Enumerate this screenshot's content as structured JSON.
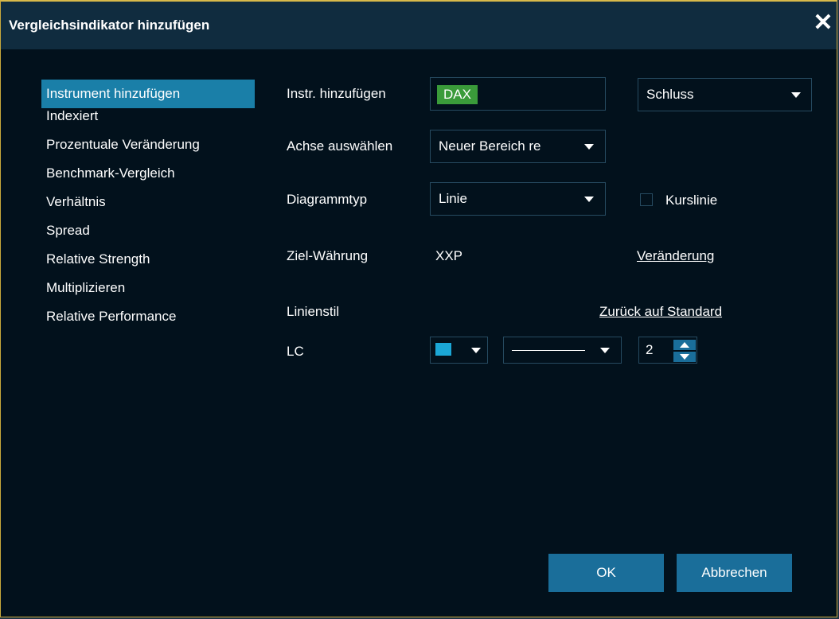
{
  "dialog": {
    "title": "Vergleichsindikator hinzufügen",
    "close_glyph": "✕"
  },
  "sidebar": {
    "items": [
      {
        "label": "Instrument hinzufügen",
        "active": true
      },
      {
        "label": "Indexiert"
      },
      {
        "label": "Prozentuale Veränderung"
      },
      {
        "label": "Benchmark-Vergleich"
      },
      {
        "label": "Verhältnis"
      },
      {
        "label": "Spread"
      },
      {
        "label": "Relative Strength"
      },
      {
        "label": "Multiplizieren"
      },
      {
        "label": "Relative Performance"
      }
    ]
  },
  "form": {
    "instrument_label": "Instr. hinzufügen",
    "instrument_tag": "DAX",
    "price_field": "Schluss",
    "axis_label": "Achse auswählen",
    "axis_value": "Neuer Bereich re",
    "chart_type_label": "Diagrammtyp",
    "chart_type_value": "Linie",
    "price_line_label": "Kurslinie",
    "price_line_checked": false,
    "currency_label": "Ziel-Währung",
    "currency_value": "XXP",
    "change_link": "Veränderung",
    "line_style_label": "Linienstil",
    "reset_link": "Zurück auf Standard",
    "lc_label": "LC",
    "line_color": "#1ba7d6",
    "line_width": "2"
  },
  "buttons": {
    "ok": "OK",
    "cancel": "Abbrechen"
  },
  "colors": {
    "background": "#02111c",
    "titlebar": "#102c3f",
    "accent": "#1a7fa8",
    "button": "#1a6e9a",
    "tag": "#3a9b3a",
    "border": "#c9a93c"
  }
}
